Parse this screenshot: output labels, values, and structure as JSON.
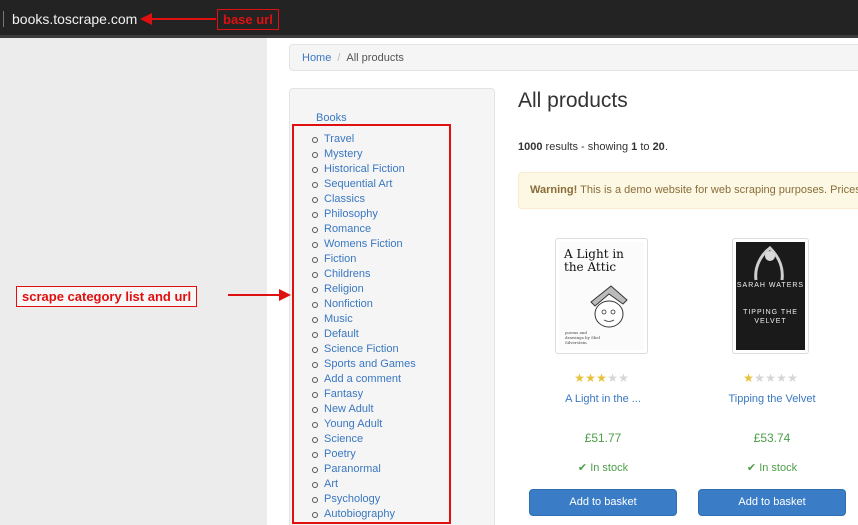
{
  "browser": {
    "url": "books.toscrape.com"
  },
  "breadcrumb": {
    "home": "Home",
    "separator": "/",
    "current": "All products"
  },
  "sidebar": {
    "title": "Books",
    "categories": [
      "Travel",
      "Mystery",
      "Historical Fiction",
      "Sequential Art",
      "Classics",
      "Philosophy",
      "Romance",
      "Womens Fiction",
      "Fiction",
      "Childrens",
      "Religion",
      "Nonfiction",
      "Music",
      "Default",
      "Science Fiction",
      "Sports and Games",
      "Add a comment",
      "Fantasy",
      "New Adult",
      "Young Adult",
      "Science",
      "Poetry",
      "Paranormal",
      "Art",
      "Psychology",
      "Autobiography"
    ]
  },
  "main": {
    "title": "All products",
    "results": {
      "total": "1000",
      "results_word": " results - showing ",
      "from": "1",
      "to_word": " to ",
      "to": "20",
      "end": "."
    },
    "warning": {
      "label": "Warning!",
      "text": " This is a demo website for web scraping purposes. Prices an"
    }
  },
  "products": [
    {
      "title": "A Light in the ...",
      "price": "£51.77",
      "stock": "In stock",
      "button": "Add to basket",
      "rating": 3,
      "cover_text": "A Light in the Attic",
      "cover_small": "poems and drawings by Shel Silverstein"
    },
    {
      "title": "Tipping the Velvet",
      "price": "£53.74",
      "stock": "In stock",
      "button": "Add to basket",
      "rating": 1,
      "cover_author": "SARAH WATERS",
      "cover_title": "TIPPING THE VELVET"
    }
  ],
  "annotations": {
    "base_url": "base url",
    "category": "scrape category list and url",
    "color": "#e01010"
  },
  "colors": {
    "link": "#3a78c1",
    "price": "#4c9e48",
    "button": "#3a7dc6",
    "star_on": "#e6c13a",
    "star_off": "#d6d6d6"
  },
  "icons": {
    "check": "check-icon",
    "star": "star-icon",
    "bullet": "bullet-icon"
  }
}
